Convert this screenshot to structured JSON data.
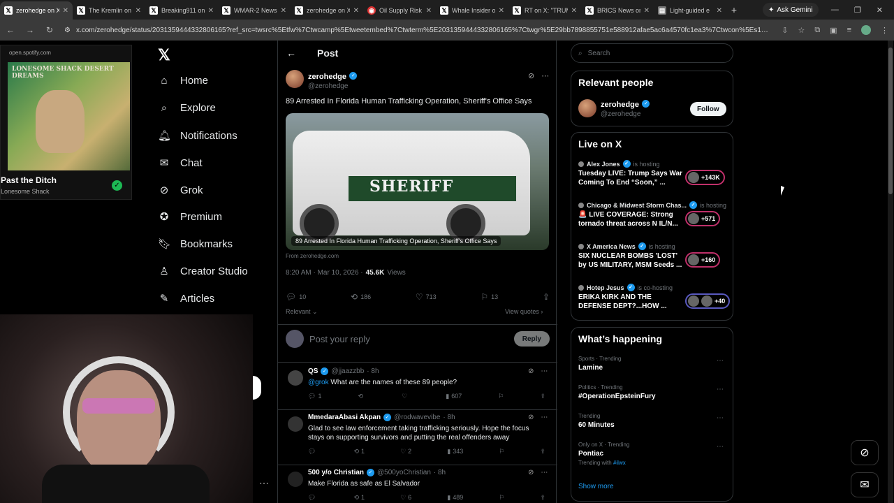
{
  "browser": {
    "tabs": [
      {
        "title": "zerohedge on X",
        "icon": "x-logo-icon"
      },
      {
        "title": "The Kremlin on",
        "icon": "x-logo-icon"
      },
      {
        "title": "Breaking911 on",
        "icon": "x-logo-icon"
      },
      {
        "title": "WMAR-2 News",
        "icon": "x-logo-icon"
      },
      {
        "title": "zerohedge on X",
        "icon": "x-logo-icon"
      },
      {
        "title": "Oil Supply Risk",
        "icon": "red-circle-icon"
      },
      {
        "title": "Whale Insider o",
        "icon": "x-logo-icon"
      },
      {
        "title": "RT on X: \"TRUM",
        "icon": "x-logo-icon"
      },
      {
        "title": "BRICS News on",
        "icon": "x-logo-icon"
      },
      {
        "title": "Light-guided e",
        "icon": "page-icon"
      }
    ],
    "new_tab": "+",
    "ask_gemini": "Ask Gemini",
    "url": "x.com/zerohedge/status/2031359444332806165?ref_src=twsrc%5Etfw%7Ctwcamp%5Etweetembed%7Ctwterm%5E2031359444332806165%7Ctwgr%5E29bb7898855751e588912afae5ac6a4570fc1ea3%7Ctwcon%5Es1_&ref_url=http%3..."
  },
  "spotify": {
    "source": "open.spotify.com",
    "art_text": "LONESOME SHACK DESERT DREAMS",
    "song": "Past the Ditch",
    "artist": "Lonesome Shack"
  },
  "nav": {
    "items": [
      {
        "label": "Home",
        "icon": "home-icon"
      },
      {
        "label": "Explore",
        "icon": "search-icon"
      },
      {
        "label": "Notifications",
        "icon": "bell-icon"
      },
      {
        "label": "Chat",
        "icon": "mail-icon"
      },
      {
        "label": "Grok",
        "icon": "grok-icon"
      },
      {
        "label": "Premium",
        "icon": "premium-icon"
      },
      {
        "label": "Bookmarks",
        "icon": "bookmark-icon"
      },
      {
        "label": "Creator Studio",
        "icon": "creator-icon"
      },
      {
        "label": "Articles",
        "icon": "articles-icon"
      }
    ]
  },
  "post": {
    "header": "Post",
    "author_name": "zerohedge",
    "author_handle": "@zerohedge",
    "text": "89 Arrested In Florida Human Trafficking Operation, Sheriff's Office Says",
    "media_caption": "89 Arrested In Florida Human Trafficking Operation, Sheriff's Office Says",
    "media_vehicle_text": "SHERIFF",
    "from": "From zerohedge.com",
    "time": "8:20 AM · Mar 10, 2026 · ",
    "views_count": "45.6K",
    "views_label": " Views",
    "replies": "10",
    "reposts": "186",
    "likes": "713",
    "bookmarks": "13",
    "sort": "Relevant",
    "view_quotes": "View quotes"
  },
  "reply_box": {
    "placeholder": "Post your reply",
    "button": "Reply"
  },
  "replies": [
    {
      "name": "QS",
      "handle": "@jjaazzbb",
      "time": "· 8h",
      "mention": "@grok",
      "text": " What are the names of these 89 people?",
      "replies": "1",
      "reposts": "",
      "likes": "",
      "views": "607"
    },
    {
      "name": "MmedaraAbasi Akpan",
      "handle": "@rodwavevibe",
      "time": "· 8h",
      "mention": "",
      "text": "Glad to see law enforcement taking trafficking seriously. Hope the focus stays on supporting survivors and putting the real offenders away",
      "replies": "",
      "reposts": "1",
      "likes": "2",
      "views": "343"
    },
    {
      "name": "500 y/o Christian",
      "handle": "@500yoChristian",
      "time": "· 8h",
      "mention": "",
      "text": "Make Florida as safe as El Salvador",
      "replies": "",
      "reposts": "1",
      "likes": "6",
      "views": "489"
    }
  ],
  "search": {
    "placeholder": "Search"
  },
  "relevant_people": {
    "title": "Relevant people",
    "name": "zerohedge",
    "handle": "@zerohedge",
    "follow": "Follow"
  },
  "live": {
    "title": "Live on X",
    "items": [
      {
        "host": "Alex Jones",
        "status": "is hosting",
        "title": "Tuesday LIVE: Trump Says War Coming To End “Soon,” ...",
        "count": "+143K"
      },
      {
        "host": "Chicago & Midwest Storm Chas...",
        "status": "is hosting",
        "title": "🚨 LIVE COVERAGE: Strong tornado threat across N IL/N...",
        "count": "+571"
      },
      {
        "host": "X America News",
        "status": "is hosting",
        "title": "SIX NUCLEAR BOMBS 'LOST' by US MILITARY, MSM Seeds ...",
        "count": "+160"
      },
      {
        "host": "Hotep Jesus",
        "status": "is co-hosting",
        "title": "ERIKA KIRK AND THE DEFENSE DEPT?...HOW ...",
        "count": "+40"
      }
    ]
  },
  "happening": {
    "title": "What’s happening",
    "items": [
      {
        "category": "Sports · Trending",
        "name": "Lamine",
        "sub_prefix": "",
        "sub_link": ""
      },
      {
        "category": "Politics · Trending",
        "name": "#OperationEpsteinFury",
        "sub_prefix": "",
        "sub_link": ""
      },
      {
        "category": "Trending",
        "name": "60 Minutes",
        "sub_prefix": "",
        "sub_link": ""
      },
      {
        "category": "Only on X · Trending",
        "name": "Pontiac",
        "sub_prefix": "Trending with ",
        "sub_link": "#ilwx"
      }
    ],
    "show_more": "Show more"
  }
}
